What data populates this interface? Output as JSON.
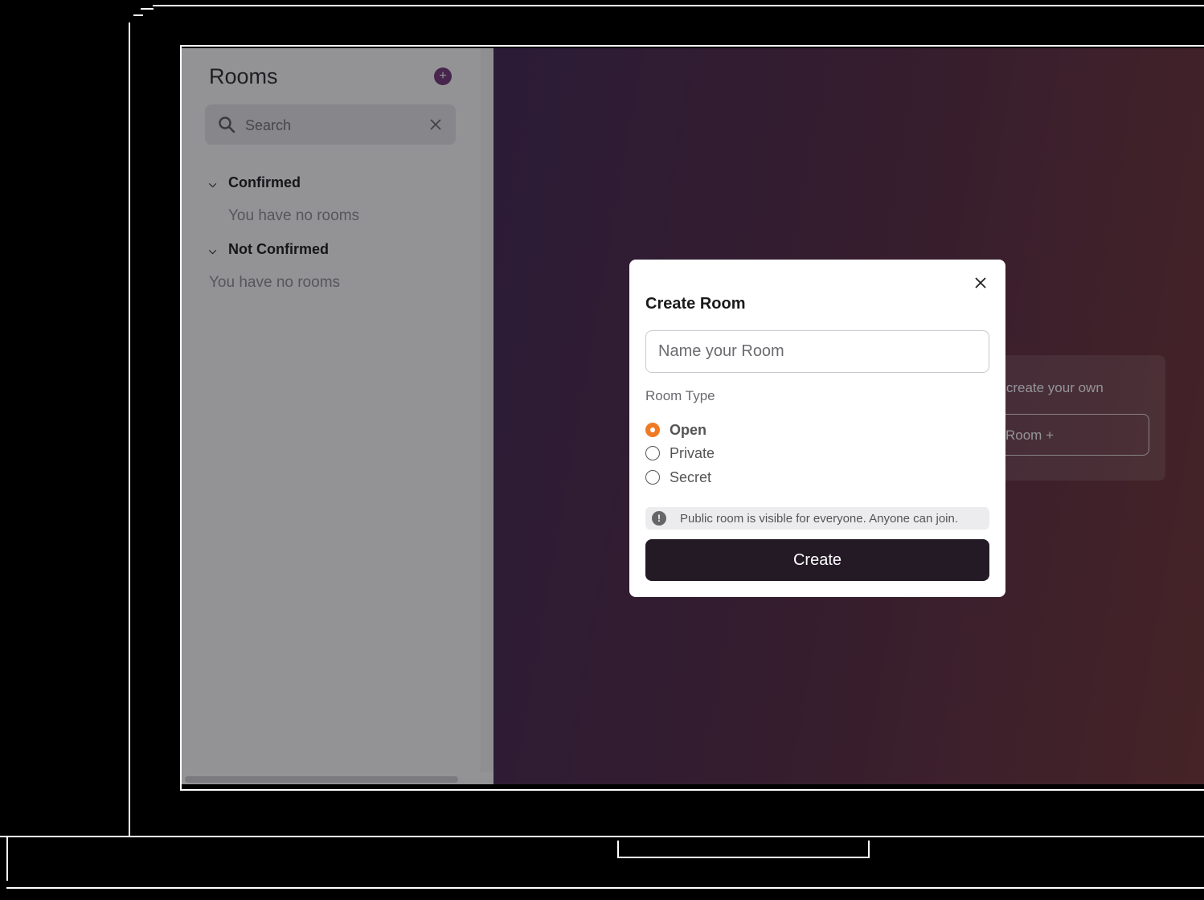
{
  "sidebar": {
    "title": "Rooms",
    "add_icon": "plus",
    "search": {
      "placeholder": "Search"
    },
    "groups": [
      {
        "label": "Confirmed",
        "empty_text": "You have no rooms"
      },
      {
        "label": "Not Confirmed",
        "empty_text": "You have no rooms"
      }
    ]
  },
  "background_card": {
    "text": "or create your own",
    "button_label": "Room +"
  },
  "modal": {
    "title": "Create Room",
    "name_placeholder": "Name your Room",
    "room_type_label": "Room Type",
    "room_types": [
      {
        "label": "Open",
        "selected": true
      },
      {
        "label": "Private",
        "selected": false
      },
      {
        "label": "Secret",
        "selected": false
      }
    ],
    "info_text": "Public room is visible for everyone. Anyone can join.",
    "create_label": "Create"
  },
  "colors": {
    "accent": "#f07a24",
    "primary_button": "#241a26",
    "add_button": "#6e2d73"
  }
}
